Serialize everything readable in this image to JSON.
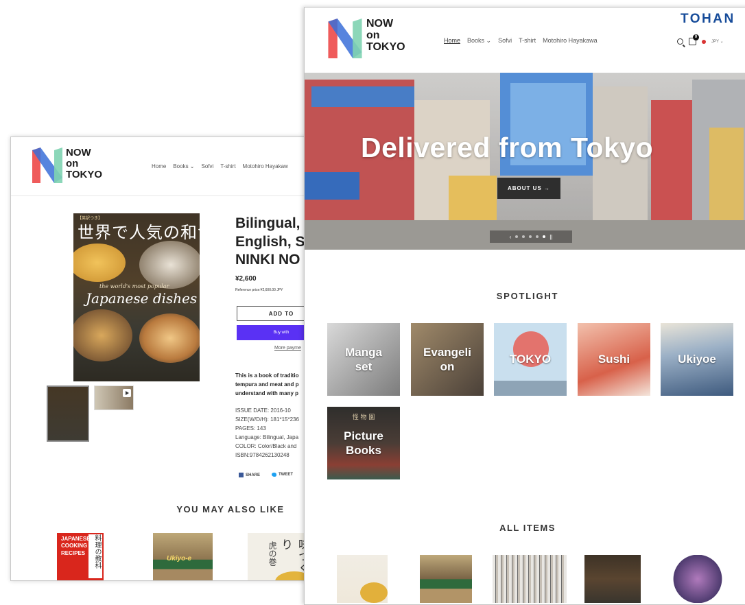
{
  "brand": {
    "line1": "NOW",
    "line2": "on",
    "line3": "TOKYO"
  },
  "back_page": {
    "nav": [
      "Home",
      "Books ⌄",
      "Sofvi",
      "T-shirt",
      "Motohiro Hayakaw"
    ],
    "book_cover": {
      "jp_small": "【英訳つき】",
      "jp_title": "世界で人気の和食",
      "en_small": "the world's most popular",
      "en_title": "Japanese dishes"
    },
    "product": {
      "title_lines": [
        "Bilingual,",
        "English, S",
        "NINKI NO"
      ],
      "price": "¥2,600",
      "reference_price": "Reference price:¥2,600.00 JPY",
      "add_to_cart": "ADD TO",
      "buy_with": "Buy with",
      "more_payment": "More payme",
      "description_lines": [
        "This is a book of traditio",
        "tempura and meat and p",
        "understand with many p"
      ],
      "specs": [
        "ISSUE DATE: 2016-10",
        "SIZE(W/D/H): 181*15*236",
        "PAGES: 143",
        "Language: Bilingual, Japa",
        "COLOR: Color/Black and",
        "ISBN:9784262130248"
      ],
      "share": "SHARE",
      "tweet": "TWEET"
    },
    "also_like": "YOU MAY ALSO LIKE",
    "related": [
      {
        "title_lines": [
          "JAPANESE",
          "COOKING",
          "RECIPES"
        ],
        "jp": "料理の教科"
      },
      {
        "title": "Ukiyo-e"
      },
      {
        "jp_big": "味づくり",
        "jp_small": "虎の巻"
      }
    ]
  },
  "front_page": {
    "nav": [
      "Home",
      "Books ⌄",
      "Sofvi",
      "T-shirt",
      "Motohiro Hayakawa"
    ],
    "tohan": "TOHAN",
    "cart_count": "0",
    "currency": "JPY ⌄",
    "hero": {
      "title": "Delivered from Tokyo",
      "button": "ABOUT US  →",
      "prev": "‹",
      "next": "||"
    },
    "spotlight_heading": "SPOTLIGHT",
    "spotlight": [
      {
        "label": "Manga\nset",
        "color": "#8a8a8a"
      },
      {
        "label": "Evangeli\non",
        "color": "#6b5a47"
      },
      {
        "label": "TOKYO",
        "color": "#9fc7e2"
      },
      {
        "label": "Sushi",
        "color": "#e3836a"
      },
      {
        "label": "Ukiyoe",
        "color": "#6e7f91"
      },
      {
        "label": "Picture\nBooks",
        "color": "#3b3d3a",
        "top_text": "怪 物 園"
      }
    ],
    "all_items_heading": "ALL ITEMS"
  },
  "colors": {
    "accent": "#5a31f4",
    "tohan_blue": "#174c9a",
    "logo_red": "#ef5b5b",
    "logo_blue": "#3a6fd8",
    "logo_green": "#7fd3b1"
  },
  "icons": [
    "search-icon",
    "cart-icon",
    "flag-icon",
    "play-icon",
    "facebook-icon",
    "twitter-icon",
    "arrow-right-icon"
  ]
}
